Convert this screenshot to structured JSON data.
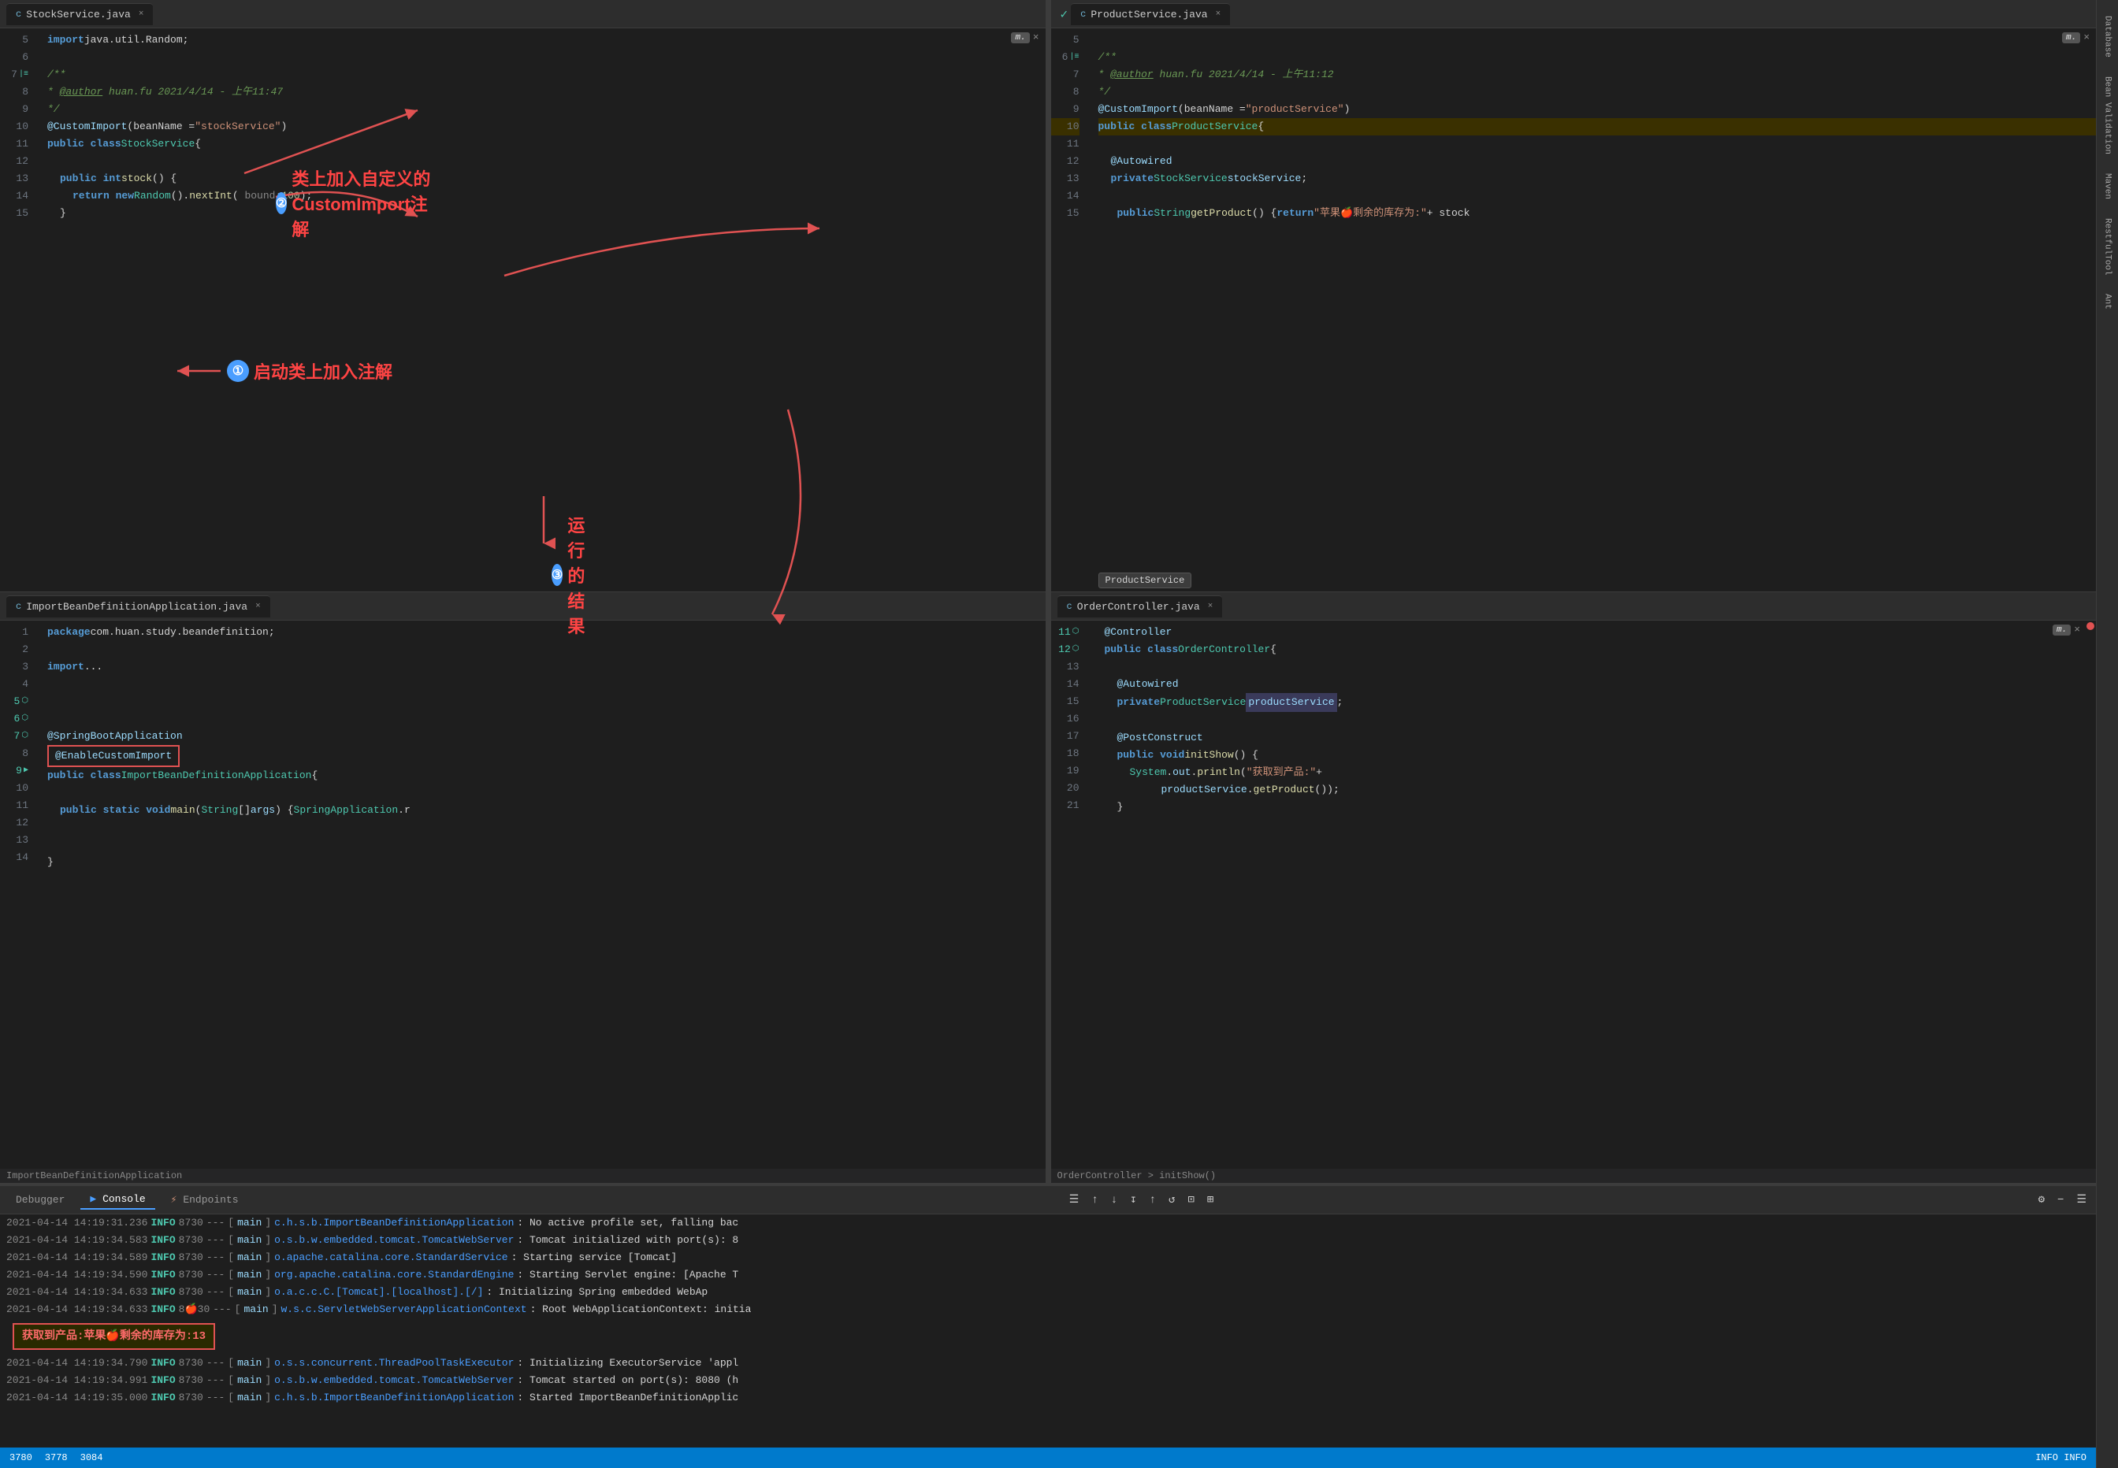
{
  "tabs": {
    "stock": "StockService.java",
    "product": "ProductService.java",
    "import": "ImportBeanDefinitionApplication.java",
    "order": "OrderController.java"
  },
  "stockService": {
    "lines": [
      {
        "n": "5",
        "code": "import java.util.Random;",
        "type": "import"
      },
      {
        "n": "6",
        "code": ""
      },
      {
        "n": "7",
        "code": "/**",
        "type": "comment"
      },
      {
        "n": "8",
        "code": " * @author huan.fu 2021/4/14 - 上午11:47",
        "type": "comment"
      },
      {
        "n": "9",
        "code": " */",
        "type": "comment"
      },
      {
        "n": "10",
        "code": "@CustomImport(beanName = \"stockService\")",
        "type": "annotation"
      },
      {
        "n": "11",
        "code": "public class StockService {",
        "type": "class"
      },
      {
        "n": "12",
        "code": ""
      },
      {
        "n": "13",
        "code": "    public int stock() {",
        "type": "method"
      },
      {
        "n": "14",
        "code": "        return new Random().nextInt( bound: 100);",
        "type": "return"
      },
      {
        "n": "15",
        "code": "    }",
        "type": "brace"
      }
    ]
  },
  "productService": {
    "lines": [
      {
        "n": "5",
        "code": ""
      },
      {
        "n": "6",
        "code": "/**",
        "type": "comment"
      },
      {
        "n": "7",
        "code": " * @author huan.fu 2021/4/14 - 上午11:12",
        "type": "comment"
      },
      {
        "n": "8",
        "code": " */",
        "type": "comment"
      },
      {
        "n": "9",
        "code": "@CustomImport(beanName = \"productService\")",
        "type": "annotation"
      },
      {
        "n": "10",
        "code": "public class ProductService {",
        "type": "class"
      },
      {
        "n": "11",
        "code": ""
      },
      {
        "n": "12",
        "code": "    @Autowired",
        "type": "annotation2"
      },
      {
        "n": "13",
        "code": "    private StockService stockService;",
        "type": "field"
      },
      {
        "n": "14",
        "code": ""
      },
      {
        "n": "15",
        "code": "        public String getProduct() { return \"苹果🍎剩余的库存为:\" + stock",
        "type": "method"
      }
    ],
    "tooltip": "ProductService"
  },
  "importApp": {
    "lines": [
      {
        "n": "1",
        "code": "package com.huan.study.beandefinition;"
      },
      {
        "n": "2",
        "code": ""
      },
      {
        "n": "3",
        "code": "import ..."
      },
      {
        "n": "4",
        "code": ""
      },
      {
        "n": "5",
        "code": ""
      },
      {
        "n": "6",
        "code": ""
      },
      {
        "n": "7",
        "code": "@SpringBootApplication"
      },
      {
        "n": "8",
        "code": "@EnableCustomImport"
      },
      {
        "n": "9",
        "code": "public class ImportBeanDefinitionApplication {"
      },
      {
        "n": "10",
        "code": ""
      },
      {
        "n": "11",
        "code": "    public static void main(String[] args) { SpringApplication.r"
      },
      {
        "n": "12",
        "code": ""
      },
      {
        "n": "13",
        "code": ""
      },
      {
        "n": "14",
        "code": "}"
      }
    ],
    "breadcrumb": "ImportBeanDefinitionApplication"
  },
  "orderController": {
    "lines": [
      {
        "n": "11",
        "code": "    @Controller"
      },
      {
        "n": "12",
        "code": "    public class OrderController {"
      },
      {
        "n": "13",
        "code": ""
      },
      {
        "n": "14",
        "code": "        @Autowired"
      },
      {
        "n": "15",
        "code": "        private ProductService productService;"
      },
      {
        "n": "16",
        "code": ""
      },
      {
        "n": "17",
        "code": "        @PostConstruct"
      },
      {
        "n": "18",
        "code": "        public void initShow() {"
      },
      {
        "n": "19",
        "code": "            System.out.println(\"获取到产品:\" +"
      },
      {
        "n": "20",
        "code": "                    productService.getProduct());"
      },
      {
        "n": "21",
        "code": "        }"
      }
    ],
    "breadcrumb": "OrderController > initShow()"
  },
  "callouts": {
    "one": {
      "num": "①",
      "text": "启动类上加入注解"
    },
    "two": {
      "num": "②",
      "text": "类上加入自定义的 CustomImport注解"
    },
    "three": {
      "num": "③",
      "text": "运行的结果"
    }
  },
  "console": {
    "tabs": {
      "debugger": "Debugger",
      "console": "Console",
      "endpoints": "Endpoints"
    },
    "logs": [
      {
        "time": "2021-04-14 14:19:31.236",
        "level": "INFO",
        "pid": "8730",
        "sep": "---",
        "thread": "main",
        "source": "c.h.s.b.ImportBeanDefinitionApplication",
        "msg": ": No active profile set, falling bac"
      },
      {
        "time": "2021-04-14 14:19:34.583",
        "level": "INFO",
        "pid": "8730",
        "sep": "---",
        "thread": "main",
        "source": "o.s.b.w.embedded.tomcat.TomcatWebServer",
        "msg": ": Tomcat initialized with port(s): 8"
      },
      {
        "time": "2021-04-14 14:19:34.589",
        "level": "INFO",
        "pid": "8730",
        "sep": "---",
        "thread": "main",
        "source": "o.apache.catalina.core.StandardService",
        "msg": ": Starting service [Tomcat]"
      },
      {
        "time": "2021-04-14 14:19:34.590",
        "level": "INFO",
        "pid": "8730",
        "sep": "---",
        "thread": "main",
        "source": "org.apache.catalina.core.StandardEngine",
        "msg": ": Starting Servlet engine: [Apache T"
      },
      {
        "time": "2021-04-14 14:19:34.633",
        "level": "INFO",
        "pid": "8730",
        "sep": "---",
        "thread": "main",
        "source": "o.a.c.c.C.[Tomcat].[localhost].[/]",
        "msg": ": Initializing Spring embedded WebAp"
      },
      {
        "time": "2021-04-14 14:19:34.633",
        "level": "INFO",
        "pid": "🍎30",
        "sep": "---",
        "thread": "main",
        "source": "w.s.c.ServletWebServerApplicationContext",
        "msg": ": Root WebApplicationContext: initia"
      },
      {
        "time": "",
        "level": "",
        "pid": "",
        "sep": "",
        "thread": "",
        "source": "",
        "msg": "获取到产品:苹果🍎剩余的库存为:13",
        "highlight": true
      },
      {
        "time": "2021-04-14 14:19:34.790",
        "level": "INFO",
        "pid": "8730",
        "sep": "---",
        "thread": "main",
        "source": "o.s.s.concurrent.ThreadPoolTaskExecutor",
        "msg": ": Initializing ExecutorService 'appl"
      },
      {
        "time": "2021-04-14 14:19:34.991",
        "level": "INFO",
        "pid": "8730",
        "sep": "---",
        "thread": "main",
        "source": "o.s.b.w.embedded.tomcat.TomcatWebServer",
        "msg": ": Tomcat started on port(s): 8080 (h"
      },
      {
        "time": "2021-04-14 14:19:35.000",
        "level": "INFO",
        "pid": "8730",
        "sep": "---",
        "thread": "main",
        "source": "c.h.s.b.ImportBeanDefinitionApplication",
        "msg": ": Started ImportBeanDefinitionApplic"
      }
    ],
    "statusNums": [
      "3780",
      "3778",
      "3084"
    ]
  },
  "sidebar": {
    "items": [
      "Database",
      "Bean Validation",
      "Maven",
      "RestfulTool",
      "Ant"
    ]
  },
  "icons": {
    "mc": "m.",
    "close": "×",
    "check": "✓",
    "run": "▶",
    "fold": "▾"
  }
}
